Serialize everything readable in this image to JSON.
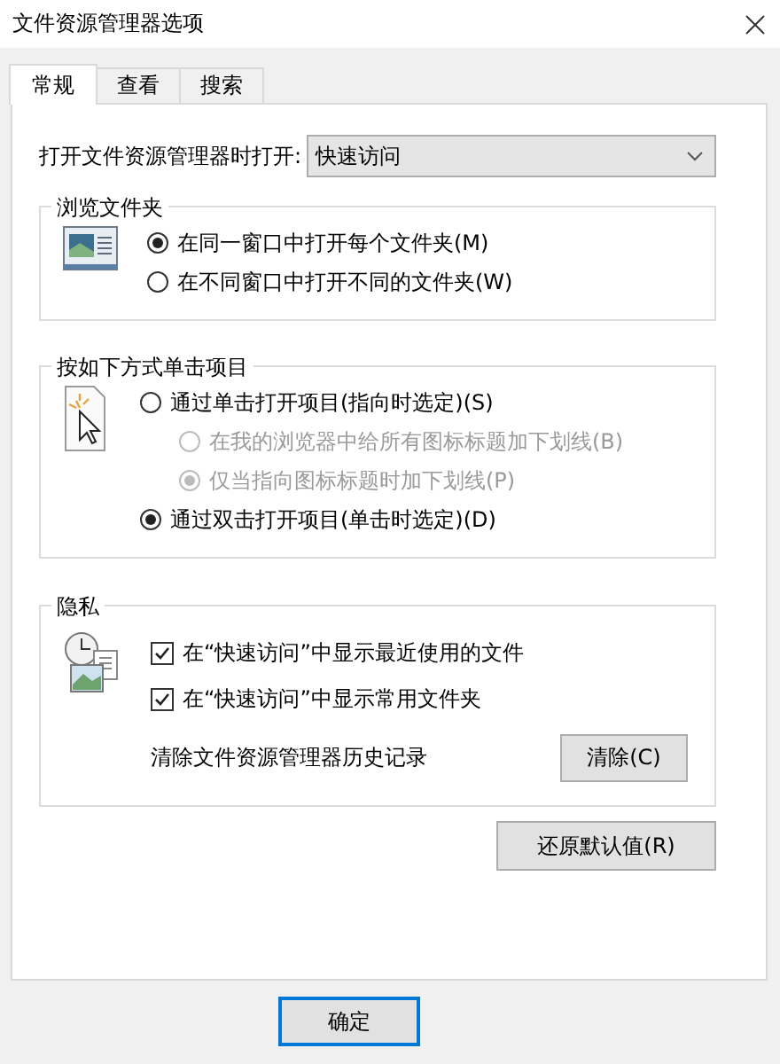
{
  "window": {
    "title": "文件资源管理器选项"
  },
  "tabs": [
    {
      "label": "常规",
      "selected": true
    },
    {
      "label": "查看",
      "selected": false
    },
    {
      "label": "搜索",
      "selected": false
    }
  ],
  "open_explorer": {
    "label": "打开文件资源管理器时打开:",
    "value": "快速访问"
  },
  "browse_folders": {
    "title": "浏览文件夹",
    "options": [
      {
        "label": "在同一窗口中打开每个文件夹(M)",
        "selected": true,
        "disabled": false
      },
      {
        "label": "在不同窗口中打开不同的文件夹(W)",
        "selected": false,
        "disabled": false
      }
    ]
  },
  "click_items": {
    "title": "按如下方式单击项目",
    "options": [
      {
        "label": "通过单击打开项目(指向时选定)(S)",
        "selected": false,
        "disabled": false,
        "children": [
          {
            "label": "在我的浏览器中给所有图标标题加下划线(B)",
            "selected": false,
            "disabled": true
          },
          {
            "label": "仅当指向图标标题时加下划线(P)",
            "selected": true,
            "disabled": true
          }
        ]
      },
      {
        "label": "通过双击打开项目(单击时选定)(D)",
        "selected": true,
        "disabled": false
      }
    ]
  },
  "privacy": {
    "title": "隐私",
    "checkboxes": [
      {
        "label": "在“快速访问”中显示最近使用的文件",
        "checked": true
      },
      {
        "label": "在“快速访问”中显示常用文件夹",
        "checked": true
      }
    ],
    "clear_label": "清除文件资源管理器历史记录",
    "clear_button": "清除(C)"
  },
  "restore_button": "还原默认值(R)",
  "footer_buttons": [
    {
      "label": "确定",
      "default": true
    }
  ]
}
